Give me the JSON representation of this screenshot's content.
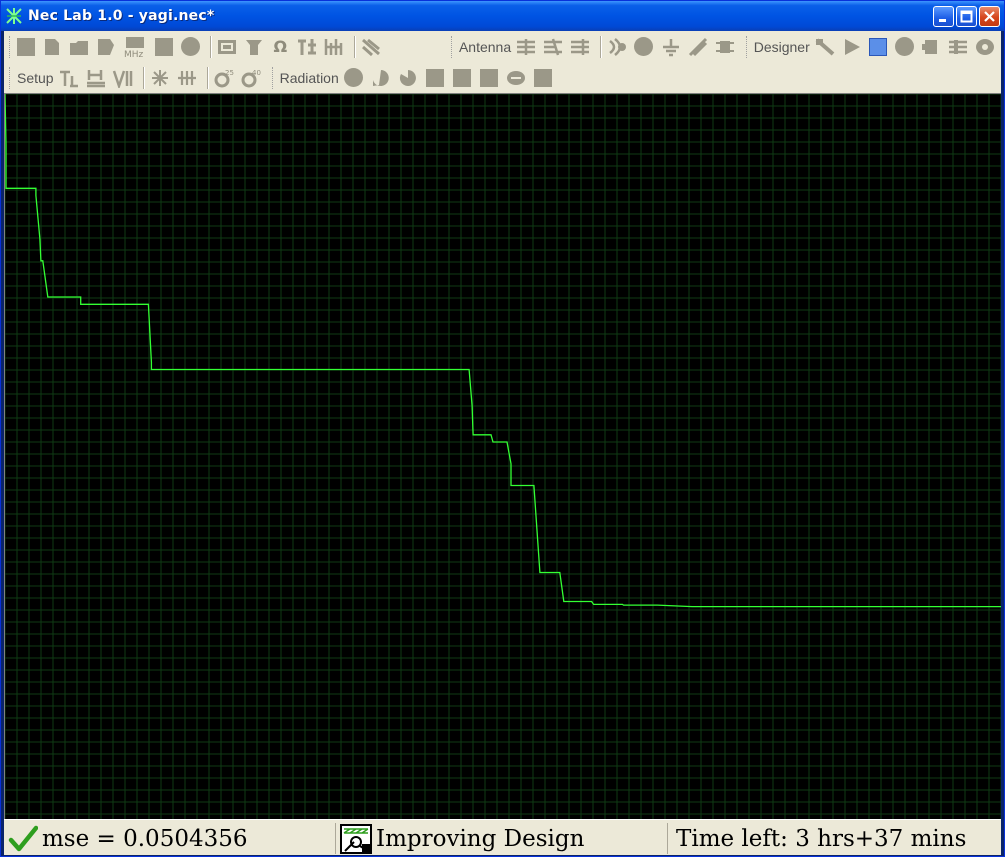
{
  "window": {
    "title": "Nec Lab 1.0 - yagi.nec*"
  },
  "toolbar": {
    "row1": {
      "group1_icons": [
        "new-icon",
        "open-icon",
        "save-icon",
        "save-as-icon",
        "frequency-icon",
        "stop-icon",
        "run-icon"
      ],
      "group1_mhz_label": "MHz",
      "group2_icons": [
        "db-icon",
        "gain-icon",
        "impedance-icon",
        "swr-icon",
        "multi-icon"
      ],
      "group3_icons": [
        "optimize-icon"
      ],
      "antenna_label": "Antenna",
      "antenna_icons": [
        "wire-add-icon",
        "wire-edit-icon",
        "wire-delete-icon",
        "source-icon",
        "load-icon",
        "ground-icon",
        "transmission-line-icon",
        "network-icon"
      ],
      "designer_label": "Designer",
      "designer_icons": [
        "designer-tool-icon",
        "designer-play-icon",
        "designer-stop-icon",
        "designer-circle-icon",
        "designer-pause-icon",
        "designer-settings-icon",
        "designer-phone-icon"
      ]
    },
    "row2": {
      "setup_label": "Setup",
      "setup_icons": [
        "setup-tl-icon",
        "setup-h-icon",
        "setup-vi-icon"
      ],
      "setup2_icons": [
        "setup-db-icon",
        "setup-db2-icon"
      ],
      "setup3_icons": [
        "angle-25-icon",
        "angle-40-icon"
      ],
      "angle_labels": [
        "25",
        "40"
      ],
      "radiation_label": "Radiation",
      "radiation_icons": [
        "pattern-1-icon",
        "pattern-2-icon",
        "pattern-3-icon",
        "pattern-4-icon",
        "pattern-5-icon",
        "pattern-6-icon",
        "pattern-7-icon",
        "pattern-8-icon"
      ]
    }
  },
  "plot": {
    "background": "#000000",
    "grid_color": "#0f3a14",
    "trace_color": "#33ff33",
    "trace": [
      [
        0.0,
        1.0
      ],
      [
        0.001,
        0.93
      ],
      [
        0.001,
        0.87
      ],
      [
        0.003,
        0.87
      ],
      [
        0.031,
        0.87
      ],
      [
        0.031,
        0.86
      ],
      [
        0.035,
        0.8
      ],
      [
        0.036,
        0.77
      ],
      [
        0.038,
        0.77
      ],
      [
        0.043,
        0.72
      ],
      [
        0.076,
        0.72
      ],
      [
        0.076,
        0.71
      ],
      [
        0.144,
        0.71
      ],
      [
        0.147,
        0.63
      ],
      [
        0.147,
        0.62
      ],
      [
        0.466,
        0.62
      ],
      [
        0.469,
        0.57
      ],
      [
        0.47,
        0.53
      ],
      [
        0.488,
        0.53
      ],
      [
        0.49,
        0.52
      ],
      [
        0.504,
        0.52
      ],
      [
        0.508,
        0.49
      ],
      [
        0.508,
        0.46
      ],
      [
        0.531,
        0.46
      ],
      [
        0.535,
        0.38
      ],
      [
        0.537,
        0.34
      ],
      [
        0.557,
        0.34
      ],
      [
        0.561,
        0.3
      ],
      [
        0.589,
        0.3
      ],
      [
        0.591,
        0.296
      ],
      [
        0.62,
        0.296
      ],
      [
        0.621,
        0.295
      ],
      [
        0.655,
        0.295
      ],
      [
        0.69,
        0.293
      ],
      [
        0.7,
        0.293
      ],
      [
        1.0,
        0.293
      ]
    ]
  },
  "status": {
    "mse_text": "mse = 0.0504356",
    "state_text": "Improving Design",
    "time_text": "Time left:  3 hrs+37 mins"
  },
  "colors": {
    "titlebar": "#0054e3",
    "toolbar_bg": "#ece9d8",
    "icon_disabled": "#9b9888",
    "check_green": "#2e9e1e"
  }
}
